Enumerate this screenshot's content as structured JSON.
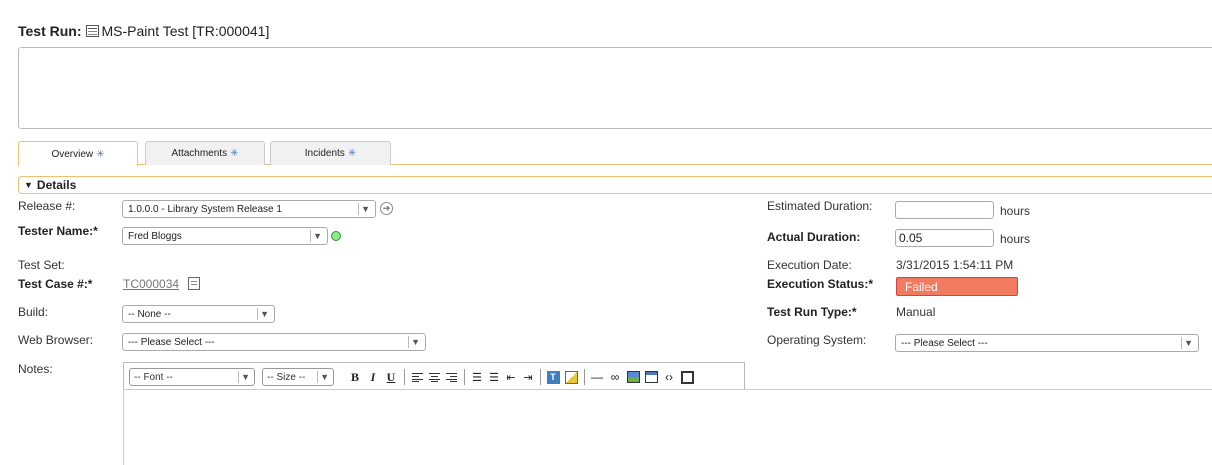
{
  "title": {
    "label": "Test Run:",
    "name": "MS-Paint Test [TR:000041]"
  },
  "tabs": [
    {
      "label": "Overview",
      "marker": "✳"
    },
    {
      "label": "Attachments",
      "marker": "✳"
    },
    {
      "label": "Incidents",
      "marker": "✳"
    }
  ],
  "section": {
    "label": "Details"
  },
  "left_fields": {
    "release": {
      "label": "Release #:",
      "value": "1.0.0.0 - Library System Release 1"
    },
    "tester": {
      "label": "Tester Name:*",
      "value": "Fred Bloggs"
    },
    "test_set": {
      "label": "Test Set:"
    },
    "test_case": {
      "label": "Test Case #:*",
      "value": "TC000034"
    },
    "build": {
      "label": "Build:",
      "value": "-- None --"
    },
    "web_browser": {
      "label": "Web Browser:",
      "value": "--- Please Select ---"
    },
    "notes": {
      "label": "Notes:"
    }
  },
  "right_fields": {
    "est_duration": {
      "label": "Estimated Duration:",
      "value": "",
      "unit": "hours"
    },
    "act_duration": {
      "label": "Actual Duration:",
      "value": "0.05",
      "unit": "hours"
    },
    "exec_date": {
      "label": "Execution Date:",
      "value": "3/31/2015 1:54:11 PM"
    },
    "exec_status": {
      "label": "Execution Status:*",
      "value": "Failed"
    },
    "run_type": {
      "label": "Test Run Type:*",
      "value": "Manual"
    },
    "os": {
      "label": "Operating System:",
      "value": "--- Please Select ---"
    }
  },
  "toolbar": {
    "font_label": "-- Font --",
    "size_label": "-- Size --",
    "bold": "B",
    "italic": "I",
    "underline": "U"
  },
  "colors": {
    "accent": "#f0c070",
    "status_failed": "#f27a5f",
    "tab_marker": "#4a7ab5"
  }
}
